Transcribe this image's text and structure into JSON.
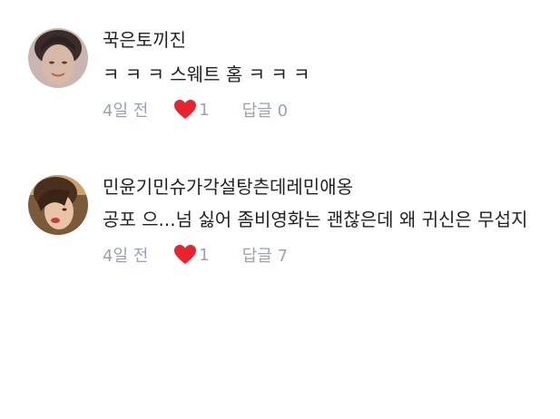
{
  "comments": [
    {
      "username": "꾹은토끼진",
      "text": "ㅋ ㅋ ㅋ 스웨트 홈 ㅋ ㅋ ㅋ",
      "time": "4일 전",
      "likes": "1",
      "reply_label": "답글",
      "reply_count": "0",
      "heart_color": "#e8232e"
    },
    {
      "username": "민윤기민슈가각설탕츤데레민애옹",
      "text": "공포 으...넘 싫어 좀비영화는 괜찮은데 왜 귀신은 무섭지",
      "time": "4일 전",
      "likes": "1",
      "reply_label": "답글",
      "reply_count": "7",
      "heart_color": "#e8232e"
    }
  ]
}
